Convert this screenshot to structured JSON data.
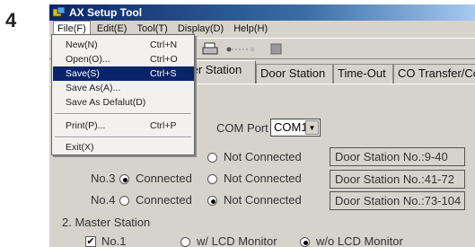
{
  "step_number": "4",
  "window": {
    "title": "AX Setup Tool"
  },
  "menubar": [
    "File(F)",
    "Edit(E)",
    "Tool(T)",
    "Display(D)",
    "Help(H)"
  ],
  "file_menu": {
    "items": [
      {
        "label": "New(N)",
        "shortcut": "Ctrl+N"
      },
      {
        "label": "Open(O)...",
        "shortcut": "Ctrl+O"
      },
      {
        "label": "Save(S)",
        "shortcut": "Ctrl+S"
      },
      {
        "label": "Save As(A)...",
        "shortcut": ""
      },
      {
        "label": "Save As Defalut(D)",
        "shortcut": ""
      },
      {
        "label": "Print(P)...",
        "shortcut": "Ctrl+P"
      },
      {
        "label": "Exit(X)",
        "shortcut": ""
      }
    ],
    "highlighted": "Save(S)"
  },
  "tabs": [
    "ter Station",
    "Door Station",
    "Time-Out",
    "CO Transfer/Comr"
  ],
  "com_port": {
    "label": "COM Port",
    "value": "COM1"
  },
  "stations": [
    {
      "name": "",
      "connected_label": "",
      "not_connected_label": "Not Connected",
      "range": "Door Station No.:9-40"
    },
    {
      "name": "No.3",
      "connected_label": "Connected",
      "not_connected_label": "Not Connected",
      "range": "Door Station No.:41-72"
    },
    {
      "name": "No.4",
      "connected_label": "Connected",
      "not_connected_label": "Not Connected",
      "range": "Door Station No.:73-104"
    }
  ],
  "master_station": {
    "heading": "2. Master Station",
    "no1_label": "No.1",
    "with_lcd": "w/ LCD Monitor",
    "without_lcd": "w/o LCD Monitor"
  },
  "colors": {
    "titlebar_start": "#0a246a",
    "titlebar_end": "#a6caf0",
    "highlight": "#0a246a"
  }
}
